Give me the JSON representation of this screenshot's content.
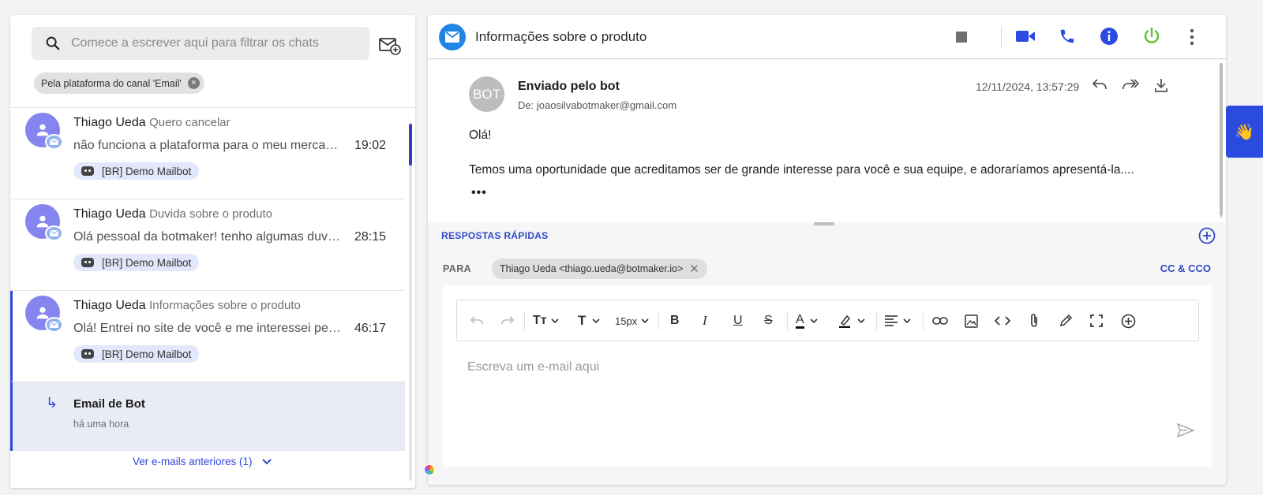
{
  "sidebar": {
    "search_placeholder": "Comece a escrever aqui para filtrar os chats",
    "filter_chip": "Pela plataforma do canal 'Email'",
    "chats": [
      {
        "name": "Thiago Ueda",
        "subject": "Quero cancelar",
        "preview": "não funciona a plataforma para o meu mercado...",
        "time": "19:02",
        "bot": "[BR] Demo Mailbot"
      },
      {
        "name": "Thiago Ueda",
        "subject": "Duvida sobre o produto",
        "preview": "Olá pessoal da botmaker! tenho algumas duvidas...",
        "time": "28:15",
        "bot": "[BR] Demo Mailbot"
      },
      {
        "name": "Thiago Ueda",
        "subject": "Informações sobre o produto",
        "preview": "Olá! Entrei no site de você e me interessei pelo produto",
        "time": "46:17",
        "bot": "[BR] Demo Mailbot"
      }
    ],
    "sub_item": {
      "title": "Email de Bot",
      "time": "há uma hora"
    },
    "older_link": "Ver e-mails anteriores (1)"
  },
  "conversation": {
    "title": "Informações sobre o produto",
    "message": {
      "avatar_text": "BOT",
      "sender": "Enviado pelo bot",
      "from": "De: joaosilvabotmaker@gmail.com",
      "date": "12/11/2024, 13:57:29",
      "line1": "Olá!",
      "line2": "Temos uma oportunidade que acreditamos ser de grande interesse para você e sua equipe, e adoraríamos apresentá-la....",
      "more": "•••"
    }
  },
  "composer": {
    "quick_replies": "RESPOSTAS RÁPIDAS",
    "to_label": "PARA",
    "recipient": "Thiago Ueda <thiago.ueda@botmaker.io>",
    "cc_label": "CC & CCO",
    "font_size": "15px",
    "placeholder": "Escreva um e-mail aqui"
  },
  "colors": {
    "accent": "#2e49c8",
    "avatar": "#8585ef",
    "power": "#5bc236",
    "mail_icon": "#2185e5"
  }
}
